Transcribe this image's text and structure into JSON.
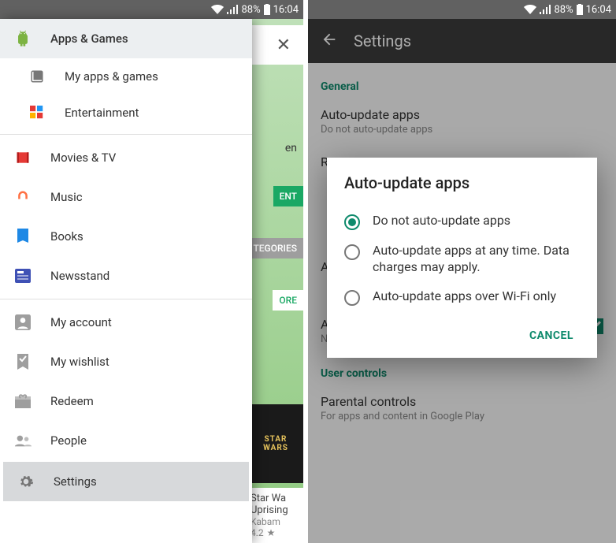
{
  "status": {
    "battery_pct": "88%",
    "time": "16:04"
  },
  "left": {
    "close_glyph": "✕",
    "bg_badges": {
      "en_suffix": "en",
      "ent": "ENT",
      "categories": "TEGORIES",
      "ore": "ORE"
    },
    "bg_card_text": "STAR\nWARS",
    "bg_footer": {
      "title1": "Star Wa",
      "title2": "Uprising",
      "subtitle": "Kabam",
      "rating": "4.2",
      "star": "★"
    },
    "drawer": {
      "apps_games": "Apps & Games",
      "my_apps": "My apps & games",
      "entertainment": "Entertainment",
      "movies": "Movies & TV",
      "music": "Music",
      "books": "Books",
      "newsstand": "Newsstand",
      "account": "My account",
      "wishlist": "My wishlist",
      "redeem": "Redeem",
      "people": "People",
      "settings": "Settings"
    }
  },
  "right": {
    "appbar_title": "Settings",
    "sections": {
      "general": "General",
      "user_controls": "User controls"
    },
    "settings": {
      "auto_update": {
        "title": "Auto-update apps",
        "sub": "Do not auto-update apps"
      },
      "r_letter": "R",
      "a_letter": "A",
      "apps_updated": {
        "title": "Apps were auto-updated",
        "sub": "Notify when apps are automatically updated"
      },
      "parental": {
        "title": "Parental controls",
        "sub": "For apps and content in Google Play"
      }
    },
    "dialog": {
      "title": "Auto-update apps",
      "options": [
        "Do not auto-update apps",
        "Auto-update apps at any time. Data charges may apply.",
        "Auto-update apps over Wi-Fi only"
      ],
      "cancel": "CANCEL",
      "selected_index": 0
    }
  }
}
